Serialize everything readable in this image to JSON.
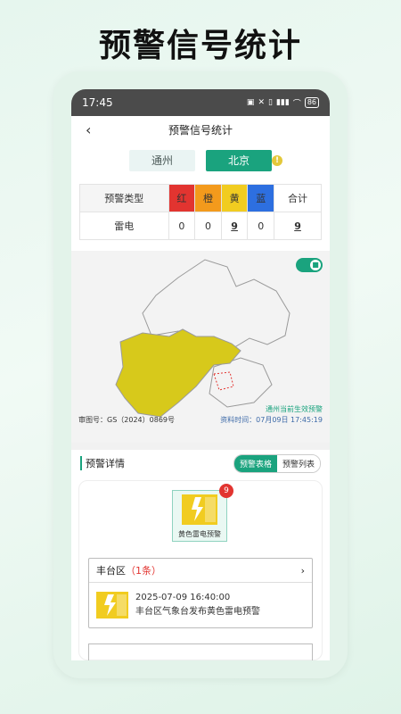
{
  "promo": {
    "title": "预警信号统计"
  },
  "status_bar": {
    "time": "17:45",
    "battery": "86"
  },
  "nav": {
    "title": "预警信号统计"
  },
  "region_tabs": {
    "tab1": "通州",
    "tab2": "北京",
    "active": "北京"
  },
  "stats": {
    "headers": {
      "type": "预警类型",
      "red": "红",
      "orange": "橙",
      "yellow": "黄",
      "blue": "蓝",
      "total": "合计"
    },
    "row": {
      "type": "雷电",
      "red": "0",
      "orange": "0",
      "yellow": "9",
      "blue": "0",
      "total": "9"
    }
  },
  "map": {
    "caption_title": "通州当前生效预警",
    "caption_time": "资料时间：07月09日 17:45:19",
    "approval": "审图号：GS（2024）0869号",
    "colors": {
      "yellow_region": "#d7c91b",
      "border": "#9a9a9a",
      "highlight": "#e23430"
    }
  },
  "detail": {
    "title": "预警详情",
    "view_table": "预警表格",
    "view_list": "预警列表",
    "tile_label": "黄色雷电预警",
    "tile_badge": "9",
    "district_name": "丰台区",
    "district_count": "（1条）",
    "item_time": "2025-07-09 16:40:00",
    "item_text": "丰台区气象台发布黄色雷电预警"
  },
  "colors": {
    "accent": "#1aa37e",
    "red": "#e23430",
    "orange": "#f39a1c",
    "yellow": "#f1cc20",
    "blue": "#2d6fe0"
  }
}
